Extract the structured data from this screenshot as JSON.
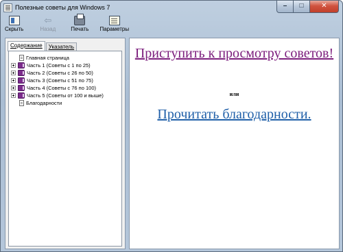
{
  "window": {
    "title": "Полезные советы для Windows 7",
    "min_symbol": "–",
    "max_symbol": "□",
    "close_symbol": "✕"
  },
  "toolbar": {
    "hide_label": "Скрыть",
    "back_label": "Назад",
    "back_symbol": "⇦",
    "print_label": "Печать",
    "options_label": "Параметры"
  },
  "left_pane": {
    "tabs": [
      {
        "label": "Содержание",
        "active": true
      },
      {
        "label": "Указатель",
        "active": false
      }
    ],
    "tree": [
      {
        "label": "Главная страница",
        "type": "page"
      },
      {
        "label": "Часть 1 (Советы с 1 по 25)",
        "type": "book"
      },
      {
        "label": "Часть 2 (Советы с 26 по 50)",
        "type": "book"
      },
      {
        "label": "Часть 3 (Советы с 51 по 75)",
        "type": "book"
      },
      {
        "label": "Часть 4 (Советы с 76 по 100)",
        "type": "book"
      },
      {
        "label": "Часть 5 (Советы от 100 и выше)",
        "type": "book"
      },
      {
        "label": "Благодарности",
        "type": "page"
      }
    ]
  },
  "content": {
    "start_link": "Приступить к просмотру советов!",
    "or_text": "или",
    "thanks_link": "Прочитать благодарности."
  },
  "colors": {
    "visited_link": "#7b1d7c",
    "link": "#1f5fa8",
    "book_icon": "#7d2c8c"
  }
}
